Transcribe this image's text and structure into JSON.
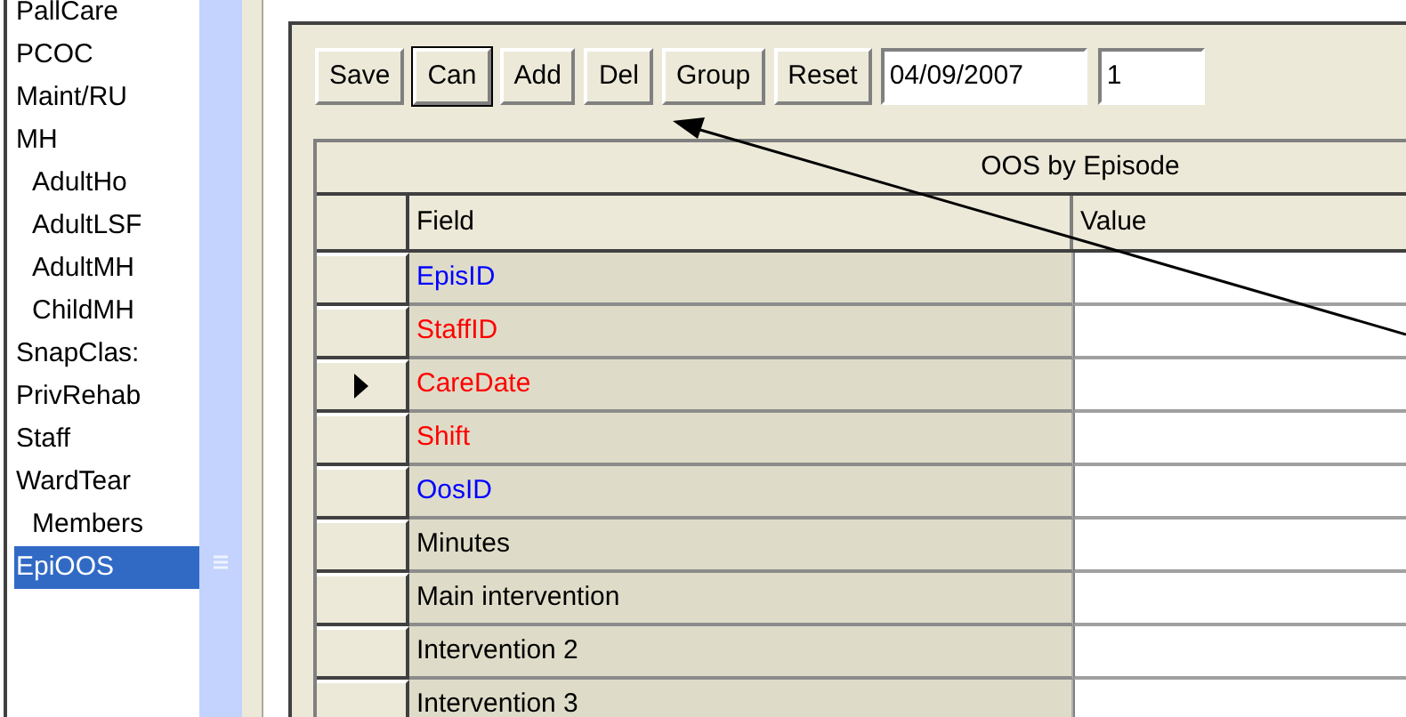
{
  "nav_list": {
    "items": [
      {
        "label": "PallCare",
        "selected": false
      },
      {
        "label": "PCOC",
        "selected": false
      },
      {
        "label": "Maint/RU",
        "selected": false
      },
      {
        "label": "MH",
        "selected": false,
        "children": [
          {
            "label": "AdultHo",
            "selected": false
          },
          {
            "label": "AdultLSF",
            "selected": false
          },
          {
            "label": "AdultMH",
            "selected": false
          },
          {
            "label": "ChildMH",
            "selected": false
          }
        ]
      },
      {
        "label": "SnapClas:",
        "selected": false
      },
      {
        "label": "PrivRehab",
        "selected": false
      },
      {
        "label": "Staff",
        "selected": false
      },
      {
        "label": "WardTear",
        "selected": false,
        "children": [
          {
            "label": "Members",
            "selected": false
          }
        ]
      },
      {
        "label": "EpiOOS",
        "selected": true
      }
    ]
  },
  "toolbar": {
    "buttons": [
      {
        "label": "Save",
        "default": false
      },
      {
        "label": "Can",
        "default": true
      },
      {
        "label": "Add",
        "default": false
      },
      {
        "label": "Del",
        "default": false
      },
      {
        "label": "Group",
        "default": false
      },
      {
        "label": "Reset",
        "default": false
      }
    ],
    "date_field": "04/09/2007",
    "number_field": "1"
  },
  "grid": {
    "title": "OOS by Episode",
    "columns": [
      "Field",
      "Value"
    ],
    "rows": [
      {
        "field": "EpisID",
        "color": "#0000ff",
        "selected": false
      },
      {
        "field": "StaffID",
        "color": "#ff0000",
        "selected": false
      },
      {
        "field": "CareDate",
        "color": "#ff0000",
        "selected": true
      },
      {
        "field": "Shift",
        "color": "#ff0000",
        "selected": false
      },
      {
        "field": "OosID",
        "color": "#0000ff",
        "selected": false
      },
      {
        "field": "Minutes",
        "color": "#000000",
        "selected": false
      },
      {
        "field": "Main intervention",
        "color": "#000000",
        "selected": false
      },
      {
        "field": "Intervention 2",
        "color": "#000000",
        "selected": false
      },
      {
        "field": "Intervention 3",
        "color": "#000000",
        "selected": false
      }
    ]
  }
}
